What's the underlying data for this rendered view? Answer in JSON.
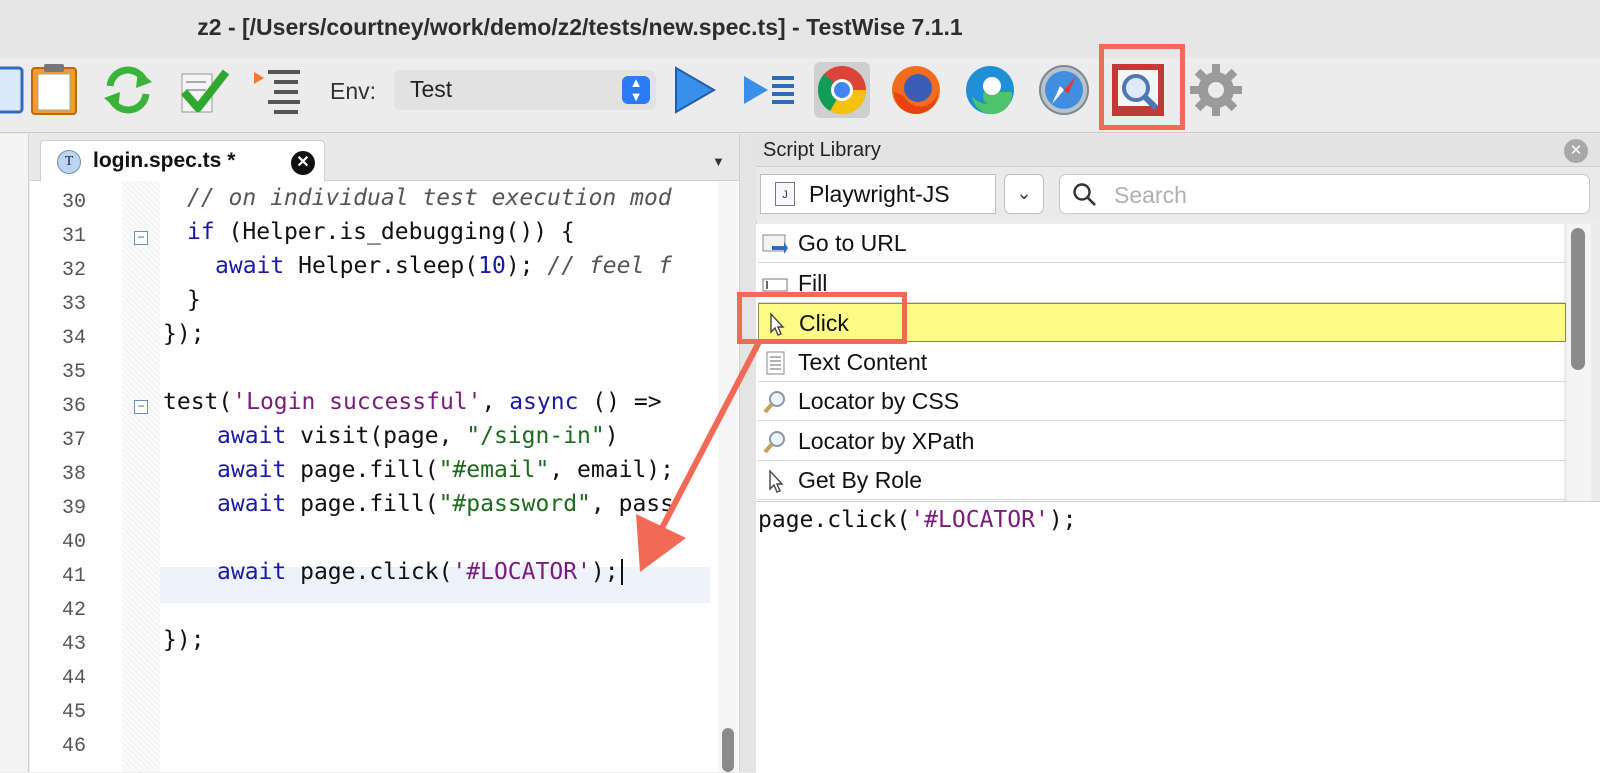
{
  "window": {
    "title": "z2 - [/Users/courtney/work/demo/z2/tests/new.spec.ts] - TestWise 7.1.1"
  },
  "toolbar": {
    "env_label": "Env:",
    "env_value": "Test",
    "buttons": [
      {
        "name": "panel-icon"
      },
      {
        "name": "clipboard-icon"
      },
      {
        "name": "refresh-icon"
      },
      {
        "name": "checklist-icon"
      },
      {
        "name": "outline-icon"
      },
      {
        "name": "run-icon"
      },
      {
        "name": "run-all-icon"
      },
      {
        "name": "chrome-icon"
      },
      {
        "name": "firefox-icon"
      },
      {
        "name": "edge-icon"
      },
      {
        "name": "safari-icon"
      },
      {
        "name": "script-library-icon"
      },
      {
        "name": "settings-icon"
      }
    ],
    "highlight_color": "#f26a55"
  },
  "editor": {
    "tab_label": "login.spec.ts *",
    "tab_icon_letter": "T",
    "line_numbers": [
      "30",
      "31",
      "32",
      "33",
      "34",
      "35",
      "36",
      "37",
      "38",
      "39",
      "40",
      "41",
      "42",
      "43",
      "44",
      "45",
      "46"
    ],
    "lines": {
      "l30": "// on individual test execution mod",
      "l31_kw": "if",
      "l31_rest": " (Helper.is_debugging()) {",
      "l32_kw": "await",
      "l32_rest": " Helper.sleep(",
      "l32_num": "10",
      "l32_tail": "); ",
      "l32_cm": "// feel f",
      "l33": "}",
      "l34": "});",
      "l36_a": "test(",
      "l36_str": "'Login successful'",
      "l36_b": ", ",
      "l36_kw": "async",
      "l36_c": " () =>",
      "l37_kw": "await",
      "l37_a": " visit(page, ",
      "l37_str": "\"/sign-in\"",
      "l37_b": ")",
      "l38_kw": "await",
      "l38_a": " page.fill(",
      "l38_str": "\"#email\"",
      "l38_b": ", email);",
      "l39_kw": "await",
      "l39_a": " page.fill(",
      "l39_str": "\"#password\"",
      "l39_b": ", pass",
      "l41_kw": "await",
      "l41_a": " page.click(",
      "l41_str": "'#LOCATOR'",
      "l41_b": ");",
      "l43": "});"
    }
  },
  "script_library": {
    "title": "Script Library",
    "framework": "Playwright-JS",
    "search_placeholder": "Search",
    "items": [
      {
        "label": "Go to URL",
        "icon": "navigate-icon"
      },
      {
        "label": "Fill",
        "icon": "textfield-icon"
      },
      {
        "label": "Click",
        "icon": "pointer-icon",
        "selected": true
      },
      {
        "label": "Text Content",
        "icon": "document-icon"
      },
      {
        "label": "Locator by CSS",
        "icon": "magnifier-icon"
      },
      {
        "label": "Locator by XPath",
        "icon": "magnifier-icon"
      },
      {
        "label": "Get By Role",
        "icon": "pointer-icon"
      }
    ],
    "snippet_a": "page.click(",
    "snippet_str": "'#LOCATOR'",
    "snippet_b": ");",
    "selected_color": "#fcfb86"
  }
}
